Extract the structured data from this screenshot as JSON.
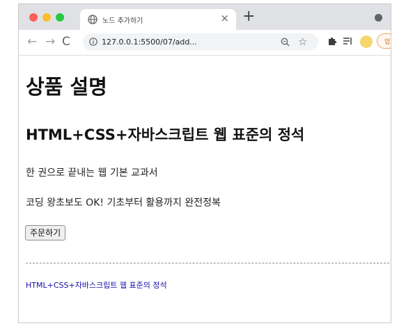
{
  "browser": {
    "tab": {
      "title": "노드 추가하기",
      "favicon": "globe-icon",
      "close_glyph": "×"
    },
    "new_tab_glyph": "+",
    "toolbar": {
      "back_glyph": "←",
      "forward_glyph": "→",
      "reload_glyph": "C",
      "url": "127.0.0.1:5500/07/add...",
      "star_glyph": "☆",
      "update_label": "업데이트",
      "update_menu_glyph": "⋮"
    },
    "colors": {
      "traffic_red": "#fe5f57",
      "traffic_yellow": "#febc2e",
      "traffic_green": "#28c840",
      "update_accent": "#e8a35a",
      "link": "#1a0dab"
    }
  },
  "page": {
    "h1": "상품 설명",
    "h2": "HTML+CSS+자바스크립트 웹 표준의 정석",
    "paragraph_1": "한 권으로 끝내는 웹 기본 교과서",
    "paragraph_2": "코딩 왕초보도 OK! 기초부터 활용까지 완전정복",
    "order_button": "주문하기",
    "link_text": "HTML+CSS+자바스크립트 웹 표준의 정석"
  }
}
